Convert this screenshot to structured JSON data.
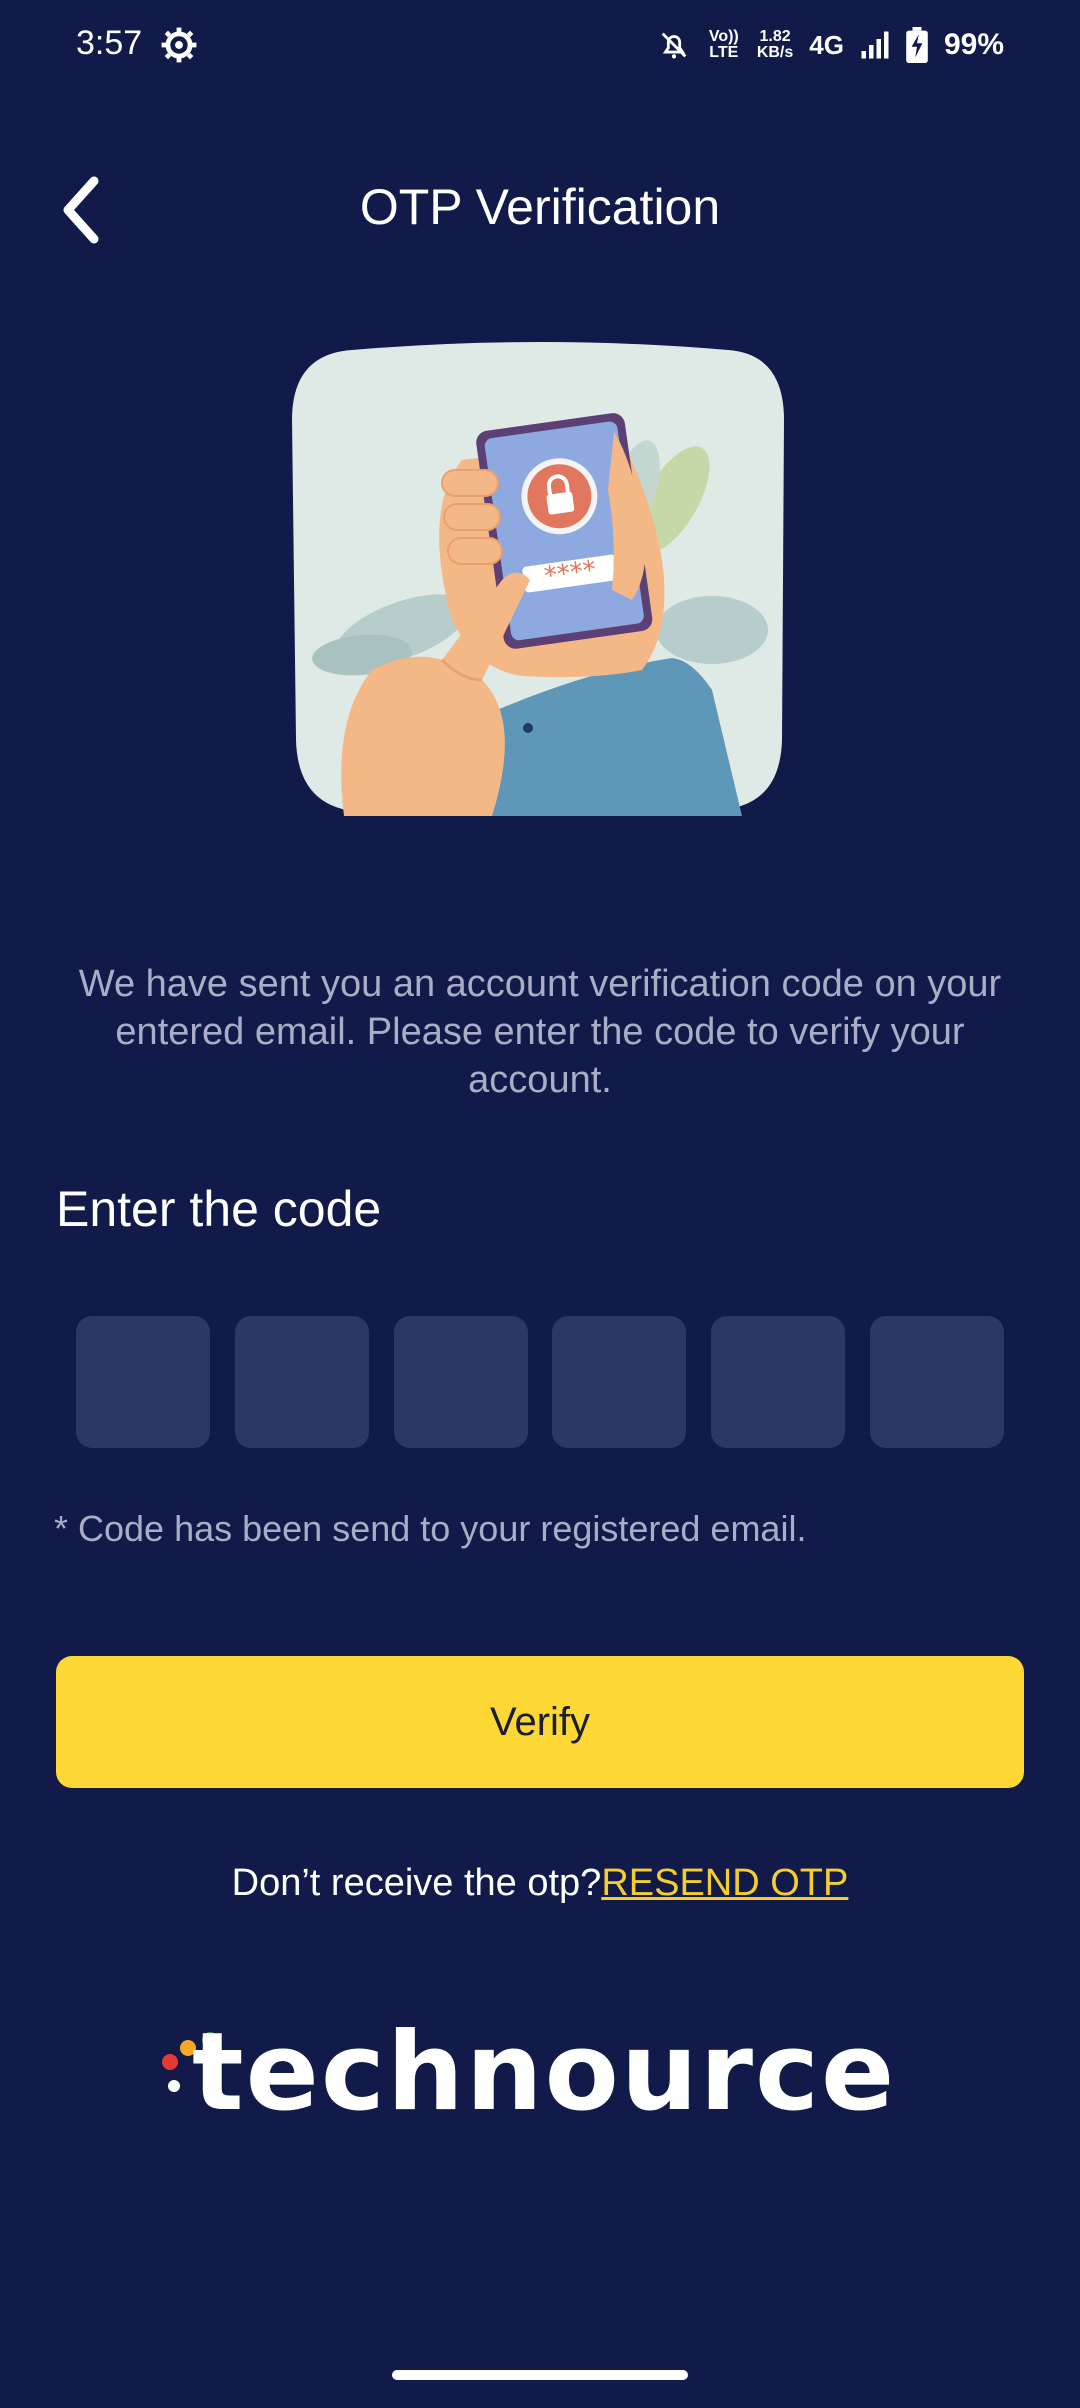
{
  "status_bar": {
    "time": "3:57",
    "volte": "Vo)) LTE",
    "speed_value": "1.82",
    "speed_unit": "KB/s",
    "network": "4G",
    "battery": "99%"
  },
  "header": {
    "title": "OTP Verification"
  },
  "description": "We have sent you an account verification code on your entered email. Please enter the code to verify your account.",
  "code": {
    "label": "Enter the code",
    "digits": [
      "",
      "",
      "",
      "",
      "",
      ""
    ],
    "note": "* Code has been send to your registered email."
  },
  "verify": {
    "label": "Verify"
  },
  "resend": {
    "prompt": "Don’t receive the otp?",
    "link": "RESEND OTP"
  },
  "brand": {
    "logo_text": "technource"
  },
  "colors": {
    "background": "#111a48",
    "accent": "#fdd835",
    "otp_box": "#2c3763",
    "muted_text": "#a9adc6"
  }
}
